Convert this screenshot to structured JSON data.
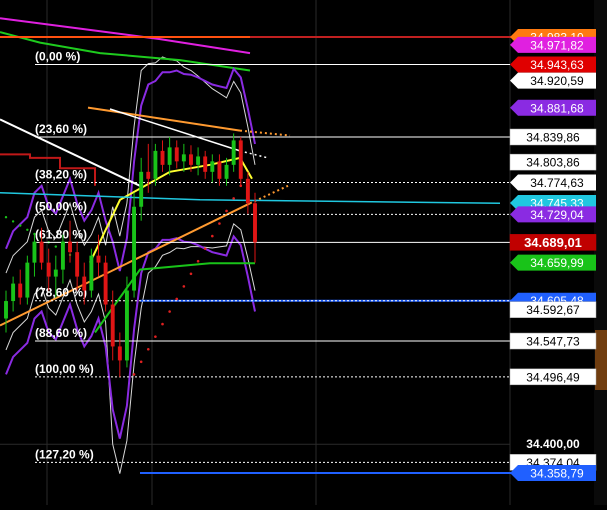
{
  "chart_data": {
    "type": "candlestick",
    "instrument_note": "",
    "colors": {
      "background": "#000000",
      "grid": "#2a2a2a",
      "fib_line": "#ffffff",
      "bull": "#19c319",
      "bear": "#e01515",
      "upper_band_magenta": "#e020e0",
      "ma_green": "#1ecb1e",
      "ma_red": "#c01818",
      "purple": "#8a2be2",
      "orange": "#ff9a30",
      "cyan": "#20c8e0",
      "yellow": "#ffff30",
      "blue": "#2060ff"
    },
    "fibonacci_levels": [
      {
        "label": "(0,00 %)",
        "price": 34943.63
      },
      {
        "label": "(23,60 %)",
        "price": 34839.86
      },
      {
        "label": "(38,20 %)",
        "price": 34774.63
      },
      {
        "label": "(50,00 %)",
        "price": 34729.04
      },
      {
        "label": "(61,80 %)",
        "price": 34689.01
      },
      {
        "label": "(78,60 %)",
        "price": 34605.48
      },
      {
        "label": "(88,60 %)",
        "price": 34547.73
      },
      {
        "label": "(100,00 %)",
        "price": 34496.49
      },
      {
        "label": "(127,20 %)",
        "price": 34374.04
      }
    ],
    "price_tags": [
      {
        "text": "34.983,10",
        "price": 34983.1,
        "bg": "#ff7a10",
        "fg": "#ffffff",
        "arrow": true,
        "partial": true
      },
      {
        "text": "34.971,82",
        "price": 34971.82,
        "bg": "#e020e0",
        "fg": "#ffffff",
        "arrow": true
      },
      {
        "text": "34.943,63",
        "price": 34943.63,
        "bg": "#e00000",
        "fg": "#ffffff",
        "arrow": true
      },
      {
        "text": "34.920,59",
        "price": 34920.59,
        "bg": "#ffffff",
        "fg": "#000000",
        "arrow": true
      },
      {
        "text": "34.881,68",
        "price": 34881.68,
        "bg": "#8a2be2",
        "fg": "#ffffff",
        "arrow": true
      },
      {
        "text": "34.839,86",
        "price": 34839.86,
        "bg": "#ffffff",
        "fg": "#000000",
        "arrow": false
      },
      {
        "text": "34.803,86",
        "price": 34803.86,
        "bg": "#ffffff",
        "fg": "#000000",
        "arrow": false
      },
      {
        "text": "34.774,63",
        "price": 34774.63,
        "bg": "#ffffff",
        "fg": "#000000",
        "arrow": true
      },
      {
        "text": "34.745,33",
        "price": 34745.33,
        "bg": "#20c8e0",
        "fg": "#ffffff",
        "arrow": true
      },
      {
        "text": "34.729,04",
        "price": 34729.04,
        "bg": "#8a2be2",
        "fg": "#ffffff",
        "arrow": true,
        "partial": true
      },
      {
        "text": "34.689,01",
        "price": 34689.01,
        "bg": "#c00000",
        "fg": "#ffffff",
        "arrow": false,
        "bold": true
      },
      {
        "text": "34.659,99",
        "price": 34659.99,
        "bg": "#19c319",
        "fg": "#ffffff",
        "arrow": true
      },
      {
        "text": "34.605,48",
        "price": 34605.48,
        "bg": "#2060ff",
        "fg": "#ffffff",
        "arrow": true
      },
      {
        "text": "34.592,67",
        "price": 34592.67,
        "bg": "#ffffff",
        "fg": "#000000",
        "arrow": false,
        "partial": true
      },
      {
        "text": "34.547,73",
        "price": 34547.73,
        "bg": "#ffffff",
        "fg": "#000000",
        "arrow": false
      },
      {
        "text": "34.496,49",
        "price": 34496.49,
        "bg": "#ffffff",
        "fg": "#000000",
        "arrow": false
      },
      {
        "text": "34.374,04",
        "price": 34374.04,
        "bg": "#ffffff",
        "fg": "#000000",
        "arrow": false,
        "partial": true
      },
      {
        "text": "34.358,79",
        "price": 34358.79,
        "bg": "#2060ff",
        "fg": "#ffffff",
        "arrow": true
      }
    ],
    "axis": {
      "ylim": [
        34313,
        35036
      ],
      "ticks": [
        {
          "price": 34400.0,
          "text": "34.400,00"
        }
      ],
      "grid": true
    },
    "candles": [
      {
        "o": 34580,
        "h": 34620,
        "l": 34560,
        "c": 34605
      },
      {
        "o": 34605,
        "h": 34640,
        "l": 34590,
        "c": 34630
      },
      {
        "o": 34630,
        "h": 34650,
        "l": 34600,
        "c": 34610
      },
      {
        "o": 34610,
        "h": 34670,
        "l": 34600,
        "c": 34660
      },
      {
        "o": 34660,
        "h": 34700,
        "l": 34640,
        "c": 34690
      },
      {
        "o": 34690,
        "h": 34710,
        "l": 34650,
        "c": 34660
      },
      {
        "o": 34660,
        "h": 34680,
        "l": 34620,
        "c": 34640
      },
      {
        "o": 34640,
        "h": 34670,
        "l": 34610,
        "c": 34650
      },
      {
        "o": 34650,
        "h": 34700,
        "l": 34630,
        "c": 34690
      },
      {
        "o": 34690,
        "h": 34720,
        "l": 34660,
        "c": 34675
      },
      {
        "o": 34675,
        "h": 34690,
        "l": 34620,
        "c": 34640
      },
      {
        "o": 34640,
        "h": 34660,
        "l": 34600,
        "c": 34620
      },
      {
        "o": 34620,
        "h": 34680,
        "l": 34610,
        "c": 34670
      },
      {
        "o": 34670,
        "h": 34700,
        "l": 34640,
        "c": 34660
      },
      {
        "o": 34660,
        "h": 34670,
        "l": 34590,
        "c": 34600
      },
      {
        "o": 34600,
        "h": 34620,
        "l": 34520,
        "c": 34540
      },
      {
        "o": 34540,
        "h": 34560,
        "l": 34496,
        "c": 34520
      },
      {
        "o": 34520,
        "h": 34640,
        "l": 34510,
        "c": 34620
      },
      {
        "o": 34620,
        "h": 34760,
        "l": 34610,
        "c": 34740
      },
      {
        "o": 34740,
        "h": 34810,
        "l": 34720,
        "c": 34790
      },
      {
        "o": 34790,
        "h": 34830,
        "l": 34760,
        "c": 34780
      },
      {
        "o": 34780,
        "h": 34830,
        "l": 34770,
        "c": 34820
      },
      {
        "o": 34820,
        "h": 34835,
        "l": 34790,
        "c": 34800
      },
      {
        "o": 34800,
        "h": 34840,
        "l": 34785,
        "c": 34825
      },
      {
        "o": 34825,
        "h": 34835,
        "l": 34795,
        "c": 34805
      },
      {
        "o": 34805,
        "h": 34830,
        "l": 34790,
        "c": 34815
      },
      {
        "o": 34815,
        "h": 34828,
        "l": 34790,
        "c": 34800
      },
      {
        "o": 34800,
        "h": 34825,
        "l": 34785,
        "c": 34812
      },
      {
        "o": 34812,
        "h": 34820,
        "l": 34780,
        "c": 34790
      },
      {
        "o": 34790,
        "h": 34815,
        "l": 34775,
        "c": 34805
      },
      {
        "o": 34805,
        "h": 34815,
        "l": 34770,
        "c": 34780
      },
      {
        "o": 34780,
        "h": 34810,
        "l": 34770,
        "c": 34800
      },
      {
        "o": 34800,
        "h": 34845,
        "l": 34790,
        "c": 34835
      },
      {
        "o": 34835,
        "h": 34840,
        "l": 34770,
        "c": 34780
      },
      {
        "o": 34780,
        "h": 34790,
        "l": 34730,
        "c": 34745
      },
      {
        "o": 34745,
        "h": 34760,
        "l": 34660,
        "c": 34689
      }
    ]
  }
}
